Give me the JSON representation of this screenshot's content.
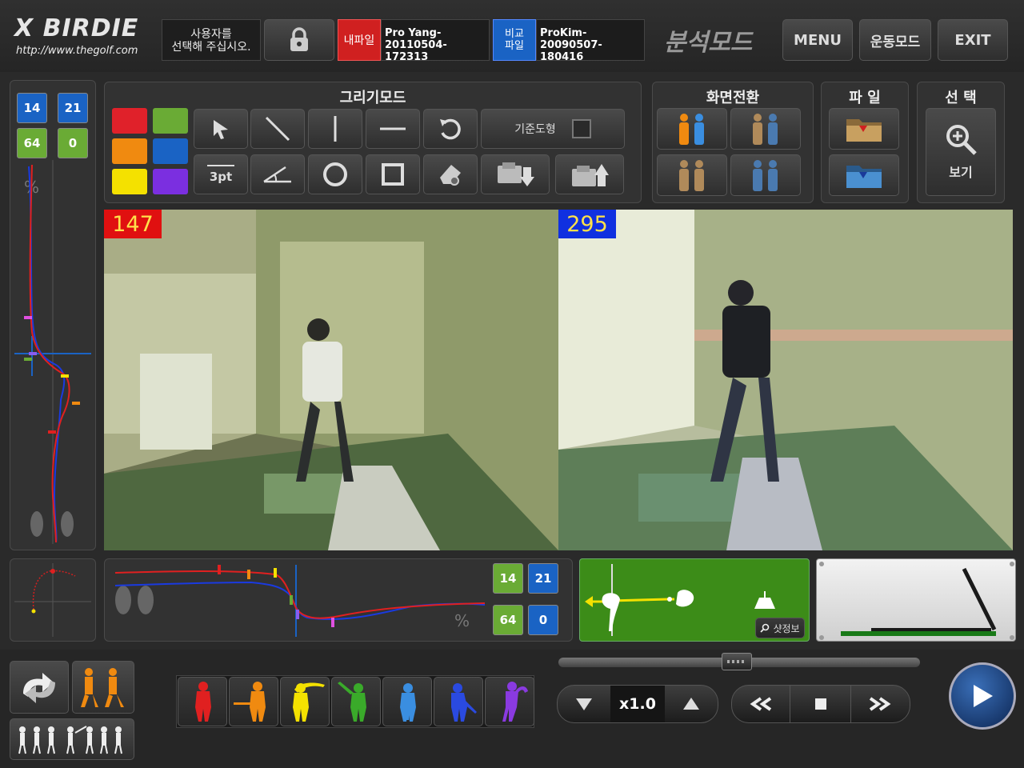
{
  "app": {
    "logo": "X BIRDIE",
    "url": "http://www.thegolf.com",
    "user_prompt_line1": "사용자를",
    "user_prompt_line2": "선택해 주십시오.",
    "my_file_label": "내파일",
    "my_file_name": "Pro Yang-20110504-172313",
    "compare_label_line1": "비교",
    "compare_label_line2": "파일",
    "compare_file_name": "ProKim-20090507-180416",
    "mode_title": "분석모드",
    "menu_label": "MENU",
    "exercise_mode_label": "운동모드",
    "exit_label": "EXIT"
  },
  "colors": {
    "red": "#e0212a",
    "green": "#6aab35",
    "orange": "#f08a10",
    "blue": "#1a63c4",
    "yellow": "#f4e100",
    "purple": "#7b2fe0",
    "file_red": "#d02020",
    "file_blue": "#1a63c4",
    "shot_green": "#3c8c18"
  },
  "left_stats": {
    "blue1": "14",
    "blue2": "21",
    "green1": "64",
    "green2": "0",
    "percent_sign": "%"
  },
  "drawing": {
    "title": "그리기모드",
    "threept_label": "3pt",
    "base_shape_label": "기준도형"
  },
  "screen_switch": {
    "title": "화면전환"
  },
  "file_section": {
    "title": "파 일"
  },
  "select_section": {
    "title": "선 택",
    "view_label": "보기"
  },
  "video": {
    "left_frame": "147",
    "right_frame": "295"
  },
  "bottom_stats": {
    "blue1": "14",
    "blue2": "21",
    "green1": "64",
    "green2": "0",
    "percent_sign": "%"
  },
  "shot_info": {
    "label": "샷정보"
  },
  "playback": {
    "speed": "x1.0"
  },
  "icons": [
    "arrow-cursor-icon",
    "line-icon",
    "vertical-line-icon",
    "horizontal-line-icon",
    "undo-icon",
    "angle-icon",
    "circle-icon",
    "square-icon",
    "eraser-icon",
    "save-icon",
    "load-icon",
    "zoom-icon",
    "lock-icon",
    "play-icon",
    "rewind-icon",
    "stop-icon",
    "fast-forward-icon",
    "down-arrow-icon",
    "up-arrow-icon",
    "footprints-icon"
  ]
}
